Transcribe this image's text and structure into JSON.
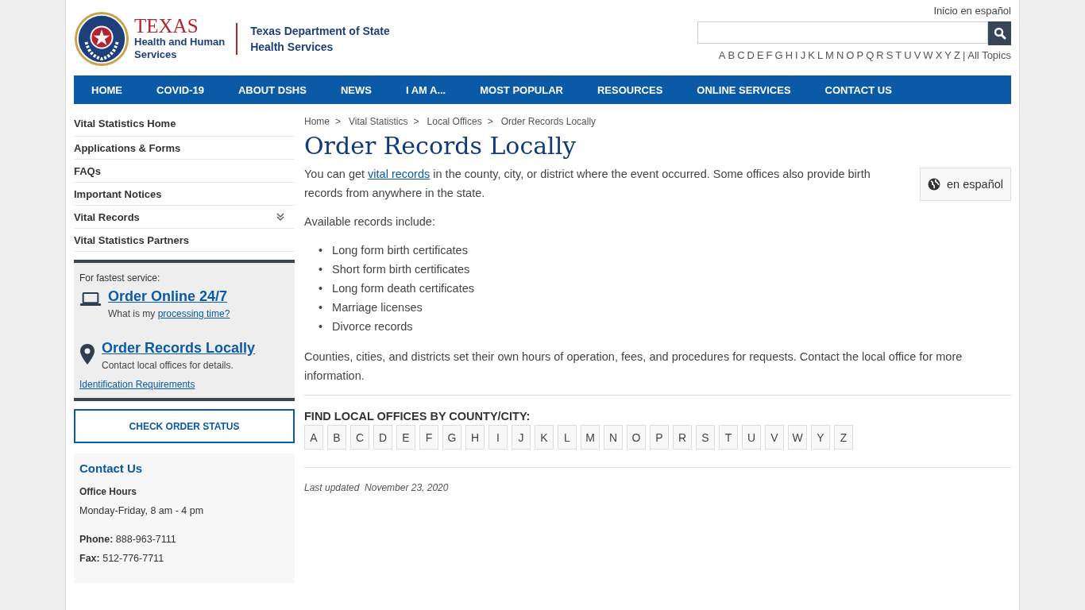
{
  "header": {
    "logo": {
      "texas": "TEXAS",
      "hhs_line1": "Health and Human",
      "hhs_line2": "Services",
      "dshs_line1": "Texas Department of State",
      "dshs_line2": "Health Services"
    },
    "spanish_link": "Inicio en español",
    "search": {
      "kind": "text"
    },
    "az_letters": [
      "A",
      "B",
      "C",
      "D",
      "E",
      "F",
      "G",
      "H",
      "I",
      "J",
      "K",
      "L",
      "M",
      "N",
      "O",
      "P",
      "Q",
      "R",
      "S",
      "T",
      "U",
      "V",
      "W",
      "X",
      "Y",
      "Z"
    ],
    "az_separator": "|",
    "all_topics": "All Topics"
  },
  "nav": {
    "items": [
      "HOME",
      "COVID-19",
      "ABOUT DSHS",
      "NEWS",
      "I AM A...",
      "MOST POPULAR",
      "RESOURCES",
      "ONLINE SERVICES",
      "CONTACT US"
    ]
  },
  "sidebar": {
    "items": [
      {
        "label": "Vital Statistics Home",
        "has_submenu": false
      },
      {
        "label": "Applications & Forms",
        "has_submenu": false
      },
      {
        "label": "FAQs",
        "has_submenu": false
      },
      {
        "label": "Important Notices",
        "has_submenu": false
      },
      {
        "label": "Vital Records",
        "has_submenu": true
      },
      {
        "label": "Vital Statistics Partners",
        "has_submenu": false
      }
    ],
    "order_box": {
      "intro": "For fastest service:",
      "online_link": "Order Online 24/7",
      "online_note": "What is my ",
      "online_note_link": "processing time?",
      "local_link": "Order Records Locally",
      "local_note": "Contact local offices for details.",
      "id_link": "Identification Requirements"
    },
    "status_button": "CHECK ORDER STATUS",
    "contact": {
      "title": "Contact Us",
      "hours_label": "Office Hours",
      "hours": "Monday-Friday, 8 am - 4 pm",
      "phone_label": "Phone:",
      "phone": "888-963-7111",
      "fax_label": "Fax:",
      "fax": "512-776-7711"
    }
  },
  "breadcrumb": [
    {
      "label": "Home",
      "separator": ">"
    },
    {
      "label": "Vital Statistics",
      "separator": ">"
    },
    {
      "label": "Local Offices",
      "separator": ">"
    },
    {
      "label": "Order Records Locally"
    }
  ],
  "title": "Order Records Locally",
  "language_button": "en español",
  "intro": {
    "before": "You can get ",
    "link": "vital records",
    "after": " in the county, city, or district where the event occurred. Some offices also provide birth records from anywhere in the state."
  },
  "records_heading": "Available records include:",
  "records": [
    {
      "marker": "•",
      "text": "Long form birth certificates"
    },
    {
      "marker": "•",
      "text": "Short form birth certificates"
    },
    {
      "marker": "•",
      "text": "Long form death certificates"
    },
    {
      "marker": "•",
      "text": "Marriage licenses"
    },
    {
      "marker": "•",
      "text": "Divorce records"
    }
  ],
  "note": "Counties, cities, and districts set their own hours of operation, fees, and procedures for requests. Contact the local office for more information.",
  "find_heading": "FIND LOCAL OFFICES BY COUNTY/CITY:",
  "county_letters": [
    "A",
    "B",
    "C",
    "D",
    "E",
    "F",
    "G",
    "H",
    "I",
    "J",
    "K",
    "L",
    "M",
    "N",
    "O",
    "P",
    "R",
    "S",
    "T",
    "U",
    "V",
    "W",
    "Y",
    "Z"
  ],
  "last_updated": {
    "label": "Last updated",
    "date": "November 23, 2020"
  }
}
